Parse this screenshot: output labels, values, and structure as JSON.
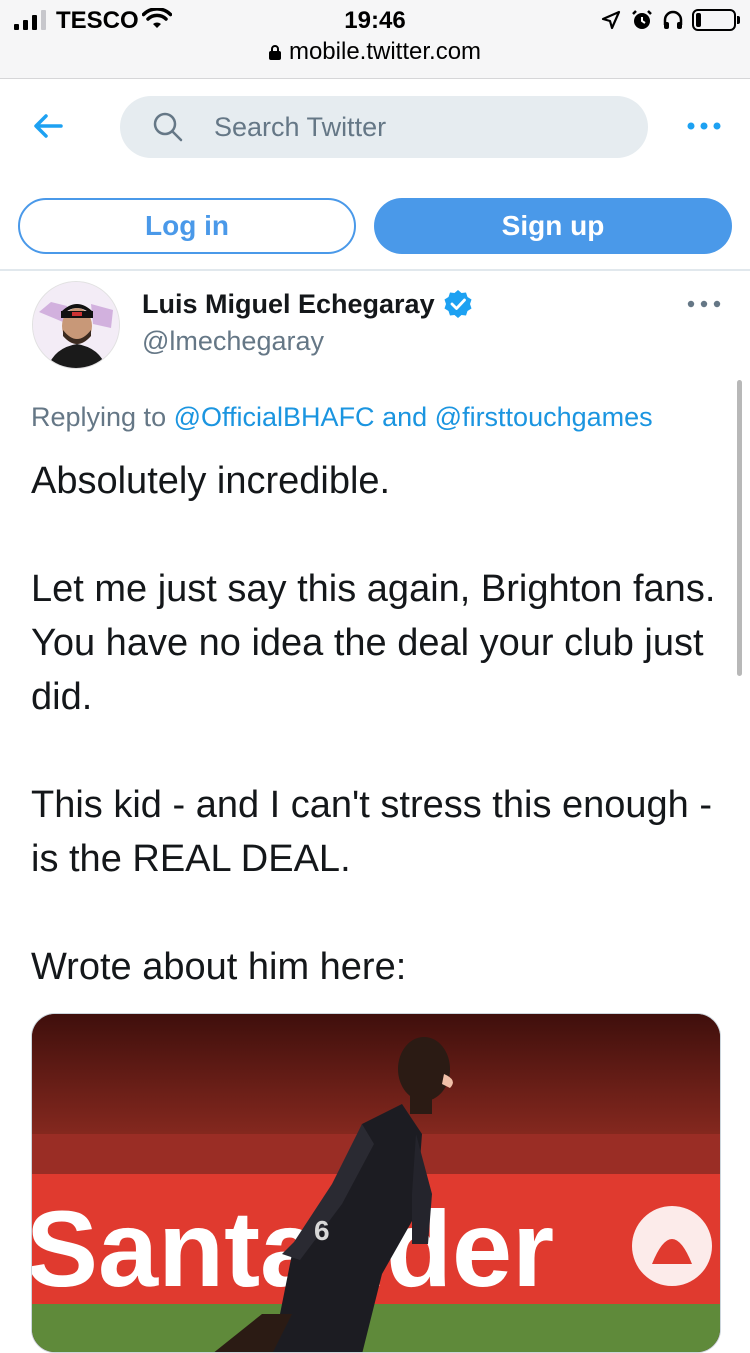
{
  "status_bar": {
    "carrier": "TESCO",
    "time": "19:46",
    "battery_level": 0.15
  },
  "browser": {
    "url": "mobile.twitter.com"
  },
  "header": {
    "search_placeholder": "Search Twitter",
    "login_label": "Log in",
    "signup_label": "Sign up"
  },
  "tweet": {
    "display_name": "Luis Miguel Echegaray",
    "handle": "@lmechegaray",
    "replying_prefix": "Replying to",
    "reply_mention_1": "@OfficialBHAFC",
    "reply_joiner": "and",
    "reply_mention_2": "@firsttouchgames",
    "text": "Absolutely incredible.\n\nLet me just say this again, Brighton fans. You have no idea the deal your club just did.\n\nThis kid - and I can't stress this enough - is the REAL DEAL.\n\nWrote about him here:",
    "media": {
      "banner_text": "Santander",
      "shirt_number": "6"
    }
  },
  "colors": {
    "accent": "#4a99e9",
    "link": "#1b95e0",
    "secondary_text": "#657786",
    "search_bg": "#e6ecf0"
  }
}
